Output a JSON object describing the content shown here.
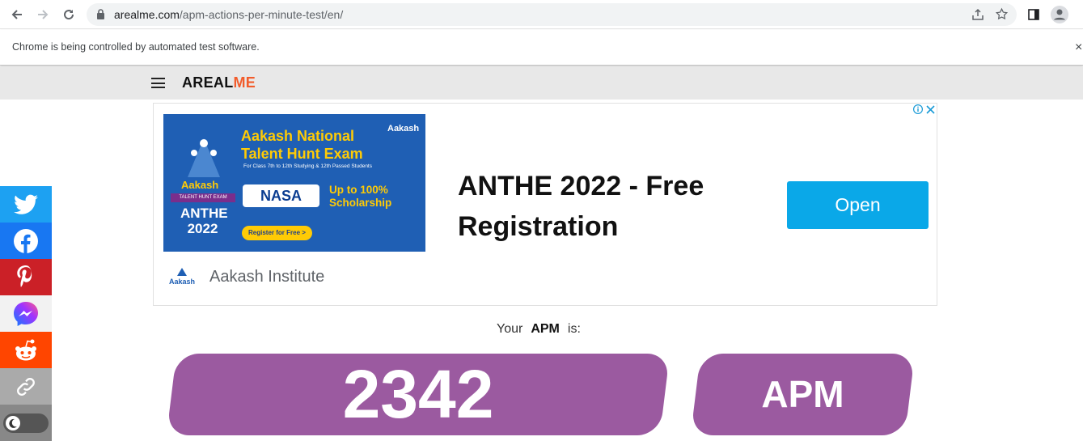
{
  "browser": {
    "url_domain": "arealme.com",
    "url_path": "/apm-actions-per-minute-test/en/",
    "infobar_text": "Chrome is being controlled by automated test software.",
    "infobar_close": "×"
  },
  "header": {
    "logo_main": "AREAL",
    "logo_accent": "ME"
  },
  "ad": {
    "banner_title": "Aakash National Talent Hunt Exam",
    "banner_sub": "For Class 7th to 12th Studying & 12th Passed Students",
    "banner_trip": "NASA",
    "banner_scholarship": "Up to 100% Scholarship",
    "banner_register": "Register for Free >",
    "banner_logo": "Aakash",
    "banner_tag": "TALENT HUNT EXAM",
    "banner_anthe": "ANTHE 2022",
    "headline": "ANTHE 2022 - Free Registration",
    "cta": "Open",
    "advertiser": "Aakash Institute",
    "advertiser_logo": "Aakash"
  },
  "result": {
    "prefix": "Your",
    "metric": "APM",
    "suffix": "is:",
    "score": "2342",
    "unit": "APM"
  },
  "colors": {
    "result_bg": "#9b5aa0",
    "logo_accent": "#f25c2b",
    "ad_button": "#0aa8e8"
  }
}
